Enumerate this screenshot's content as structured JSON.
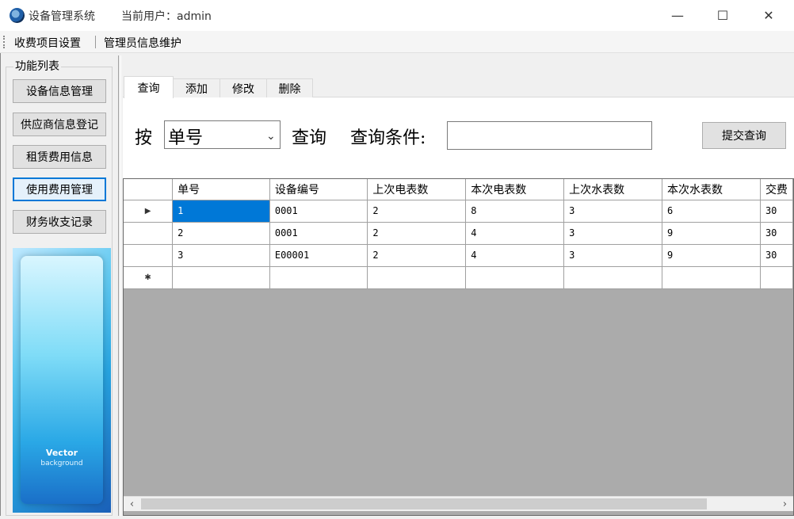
{
  "window": {
    "title": "设备管理系统",
    "user_label": "当前用户：admin",
    "minimize_icon": "—",
    "maximize_icon": "☐",
    "close_icon": "✕"
  },
  "menu": {
    "items": [
      "收费项目设置",
      "管理员信息维护"
    ]
  },
  "sidebar": {
    "group_label": "功能列表",
    "buttons": [
      {
        "label": "设备信息管理",
        "active": false
      },
      {
        "label": "供应商信息登记",
        "active": false
      },
      {
        "label": "租赁费用信息",
        "active": false
      },
      {
        "label": "使用费用管理",
        "active": true
      },
      {
        "label": "财务收支记录",
        "active": false
      }
    ],
    "banner": {
      "title": "Vector",
      "subtitle": "background"
    }
  },
  "tabs": [
    {
      "label": "查询",
      "active": true
    },
    {
      "label": "添加",
      "active": false
    },
    {
      "label": "修改",
      "active": false
    },
    {
      "label": "删除",
      "active": false
    }
  ],
  "query": {
    "by_label": "按",
    "field_value": "单号",
    "query_label": "查询",
    "condition_label": "查询条件:",
    "condition_value": "",
    "submit_label": "提交查询"
  },
  "grid": {
    "columns": [
      "单号",
      "设备编号",
      "上次电表数",
      "本次电表数",
      "上次水表数",
      "本次水表数",
      "交费"
    ],
    "rows": [
      [
        "1",
        "0001",
        "2",
        "8",
        "3",
        "6",
        "30"
      ],
      [
        "2",
        "0001",
        "2",
        "4",
        "3",
        "9",
        "30"
      ],
      [
        "3",
        "E00001",
        "2",
        "4",
        "3",
        "9",
        "30"
      ]
    ],
    "current_row_marker": "▶",
    "new_row_marker": "✱"
  },
  "scrollbar": {
    "left_arrow": "‹",
    "right_arrow": "›"
  }
}
